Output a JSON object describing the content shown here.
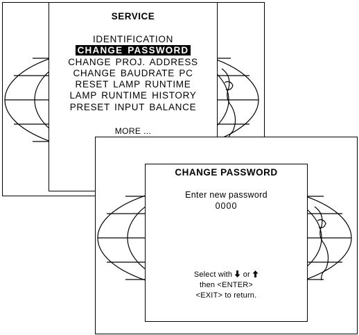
{
  "service_menu": {
    "title": "SERVICE",
    "items": [
      {
        "label": "IDENTIFICATION",
        "selected": false
      },
      {
        "label": "CHANGE PASSWORD",
        "selected": true
      },
      {
        "label": "CHANGE PROJ. ADDRESS",
        "selected": false
      },
      {
        "label": "CHANGE BAUDRATE PC",
        "selected": false
      },
      {
        "label": "RESET LAMP RUNTIME",
        "selected": false
      },
      {
        "label": "LAMP RUNTIME HISTORY",
        "selected": false
      },
      {
        "label": "PRESET INPUT BALANCE",
        "selected": false
      }
    ],
    "more": "MORE ..."
  },
  "password_dialog": {
    "title": "CHANGE PASSWORD",
    "prompt": "Enter new password",
    "value": "0000",
    "help": {
      "select_prefix": "Select with",
      "or_text": "or",
      "down_icon": "arrow-down-icon",
      "up_icon": "arrow-up-icon",
      "confirm_line": "then <ENTER>",
      "exit_line": "<EXIT> to return."
    }
  },
  "colors": {
    "background": "#ffffff",
    "foreground": "#000000",
    "highlight": "#000000",
    "highlight_text": "#ffffff"
  }
}
